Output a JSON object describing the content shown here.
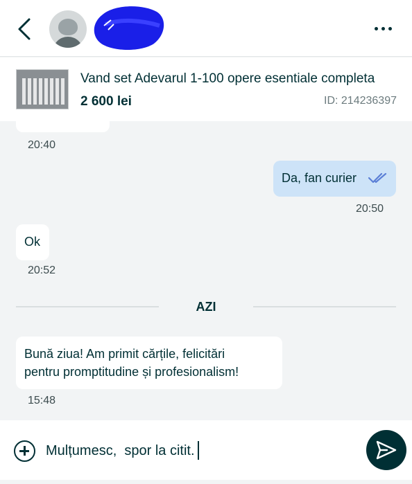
{
  "header": {
    "username": "",
    "back_icon": "chevron-left-icon",
    "more_icon": "more-horizontal-icon"
  },
  "ad": {
    "title": "Vand set Adevarul 1-100 opere esentiale completa",
    "price": "2 600 lei",
    "id": "ID: 214236397"
  },
  "messages": [
    {
      "direction": "in",
      "text": "",
      "time": "20:40"
    },
    {
      "direction": "out",
      "text": "Da, fan curier",
      "time": "20:50",
      "status_icon": "double-check-icon"
    },
    {
      "direction": "in",
      "text": "Ok",
      "time": "20:52"
    },
    {
      "direction": "in",
      "text_line1": "Bună ziua! Am primit cărțile, felicitări",
      "text_line2": "pentru promptitudine și profesionalism!",
      "time": "15:48"
    }
  ],
  "day_separator": "AZI",
  "composer": {
    "value": "Mulțumesc,  spor la citit.",
    "add_icon": "plus-circle-icon",
    "send_icon": "send-icon"
  },
  "colors": {
    "primary": "#002f34",
    "outgoing_bubble": "#cde3f8",
    "background": "#f2f4f5",
    "check_marks": "#5b7fd6",
    "redaction": "#1a1fe8"
  }
}
